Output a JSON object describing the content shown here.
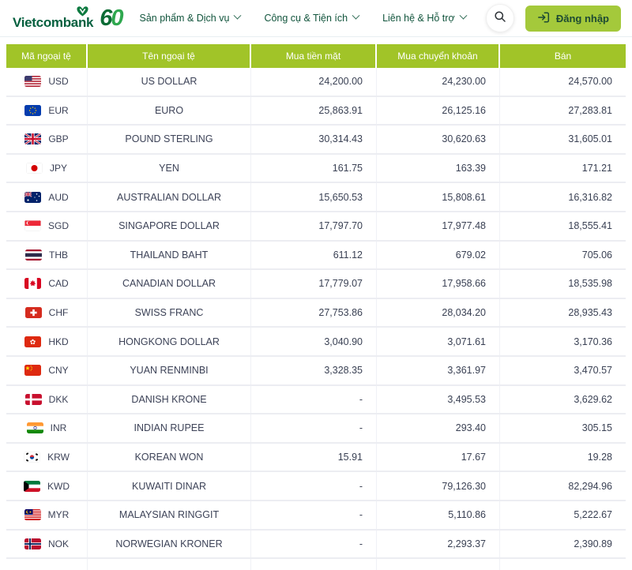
{
  "header": {
    "logo_text": "Vietcombank",
    "anniversary_text": "60",
    "nav": [
      {
        "label": "Sản phẩm & Dịch vụ"
      },
      {
        "label": "Công cụ & Tiện ích"
      },
      {
        "label": "Liên hệ & Hỗ trợ"
      }
    ],
    "login_label": "Đăng nhập"
  },
  "table": {
    "columns": [
      "Mã ngoại tệ",
      "Tên ngoại tệ",
      "Mua tiền mặt",
      "Mua chuyển khoản",
      "Bán"
    ],
    "rows": [
      {
        "code": "USD",
        "name": "US DOLLAR",
        "cash": "24,200.00",
        "transfer": "24,230.00",
        "sell": "24,570.00"
      },
      {
        "code": "EUR",
        "name": "EURO",
        "cash": "25,863.91",
        "transfer": "26,125.16",
        "sell": "27,283.81"
      },
      {
        "code": "GBP",
        "name": "POUND STERLING",
        "cash": "30,314.43",
        "transfer": "30,620.63",
        "sell": "31,605.01"
      },
      {
        "code": "JPY",
        "name": "YEN",
        "cash": "161.75",
        "transfer": "163.39",
        "sell": "171.21"
      },
      {
        "code": "AUD",
        "name": "AUSTRALIAN DOLLAR",
        "cash": "15,650.53",
        "transfer": "15,808.61",
        "sell": "16,316.82"
      },
      {
        "code": "SGD",
        "name": "SINGAPORE DOLLAR",
        "cash": "17,797.70",
        "transfer": "17,977.48",
        "sell": "18,555.41"
      },
      {
        "code": "THB",
        "name": "THAILAND BAHT",
        "cash": "611.12",
        "transfer": "679.02",
        "sell": "705.06"
      },
      {
        "code": "CAD",
        "name": "CANADIAN DOLLAR",
        "cash": "17,779.07",
        "transfer": "17,958.66",
        "sell": "18,535.98"
      },
      {
        "code": "CHF",
        "name": "SWISS FRANC",
        "cash": "27,753.86",
        "transfer": "28,034.20",
        "sell": "28,935.43"
      },
      {
        "code": "HKD",
        "name": "HONGKONG DOLLAR",
        "cash": "3,040.90",
        "transfer": "3,071.61",
        "sell": "3,170.36"
      },
      {
        "code": "CNY",
        "name": "YUAN RENMINBI",
        "cash": "3,328.35",
        "transfer": "3,361.97",
        "sell": "3,470.57"
      },
      {
        "code": "DKK",
        "name": "DANISH KRONE",
        "cash": "-",
        "transfer": "3,495.53",
        "sell": "3,629.62"
      },
      {
        "code": "INR",
        "name": "INDIAN RUPEE",
        "cash": "-",
        "transfer": "293.40",
        "sell": "305.15"
      },
      {
        "code": "KRW",
        "name": "KOREAN WON",
        "cash": "15.91",
        "transfer": "17.67",
        "sell": "19.28"
      },
      {
        "code": "KWD",
        "name": "KUWAITI DINAR",
        "cash": "-",
        "transfer": "79,126.30",
        "sell": "82,294.96"
      },
      {
        "code": "MYR",
        "name": "MALAYSIAN RINGGIT",
        "cash": "-",
        "transfer": "5,110.86",
        "sell": "5,222.67"
      },
      {
        "code": "NOK",
        "name": "NORWEGIAN KRONER",
        "cash": "-",
        "transfer": "2,293.37",
        "sell": "2,390.89"
      }
    ]
  },
  "colors": {
    "table_header_green": "#a1c428",
    "login_button_green": "#a4c93b",
    "brand_dark_green": "#06603f",
    "nav_text_green": "#11543c",
    "body_text_slate": "#3c4257"
  }
}
